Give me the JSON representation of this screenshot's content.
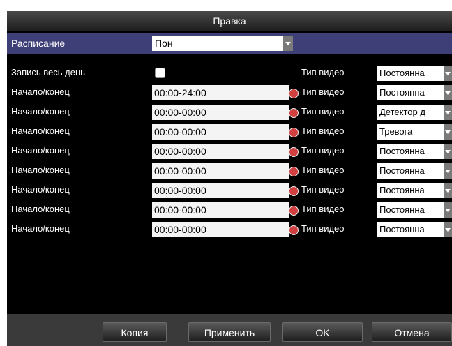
{
  "window": {
    "title": "Правка"
  },
  "schedule": {
    "label": "Расписание",
    "value": "Пон"
  },
  "allday": {
    "label": "Запись весь день",
    "checked": false,
    "type_label": "Тип видео",
    "type_value": "Постоянна"
  },
  "rows": [
    {
      "label": "Начало/конец",
      "time": "00:00-24:00",
      "type_label": "Тип видео",
      "type_value": "Постоянна"
    },
    {
      "label": "Начало/конец",
      "time": "00:00-00:00",
      "type_label": "Тип видео",
      "type_value": "Детектор д"
    },
    {
      "label": "Начало/конец",
      "time": "00:00-00:00",
      "type_label": "Тип видео",
      "type_value": "Тревога"
    },
    {
      "label": "Начало/конец",
      "time": "00:00-00:00",
      "type_label": "Тип видео",
      "type_value": "Постоянна"
    },
    {
      "label": "Начало/конец",
      "time": "00:00-00:00",
      "type_label": "Тип видео",
      "type_value": "Постоянна"
    },
    {
      "label": "Начало/конец",
      "time": "00:00-00:00",
      "type_label": "Тип видео",
      "type_value": "Постоянна"
    },
    {
      "label": "Начало/конец",
      "time": "00:00-00:00",
      "type_label": "Тип видео",
      "type_value": "Постоянна"
    },
    {
      "label": "Начало/конец",
      "time": "00:00-00:00",
      "type_label": "Тип видео",
      "type_value": "Постоянна"
    }
  ],
  "buttons": {
    "copy": "Копия",
    "apply": "Применить",
    "ok": "OK",
    "cancel": "Отмена"
  },
  "icons": {
    "clock": "clock-icon",
    "dropdown": "chevron-down-icon"
  },
  "colors": {
    "schedule_bar": "#3f3f78",
    "panel": "#000000",
    "footer": "#3a3a3a"
  }
}
